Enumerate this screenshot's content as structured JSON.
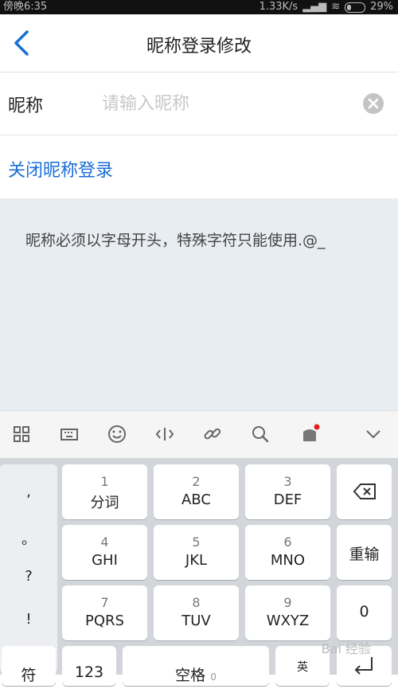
{
  "status": {
    "time": "傍晚6:35",
    "speed": "1.33K/s",
    "battery": "29%"
  },
  "nav": {
    "title": "昵称登录修改"
  },
  "nickname": {
    "label": "昵称",
    "placeholder": "请输入昵称",
    "value": ""
  },
  "close_login": {
    "label": "关闭昵称登录"
  },
  "hint": {
    "text": "昵称必须以字母开头，特殊字符只能使用.@_"
  },
  "keyboard": {
    "toolbar_icons": [
      "grid-icon",
      "keyboard-icon",
      "emoji-icon",
      "cursor-icon",
      "link-icon",
      "search-icon",
      "wallet-icon",
      "chevron-down-icon"
    ],
    "side_keys": [
      ",",
      "。",
      "?",
      "!"
    ],
    "keys": [
      {
        "num": "1",
        "label": "分词"
      },
      {
        "num": "2",
        "label": "ABC"
      },
      {
        "num": "3",
        "label": "DEF"
      },
      {
        "num": "4",
        "label": "GHI"
      },
      {
        "num": "5",
        "label": "JKL"
      },
      {
        "num": "6",
        "label": "MNO"
      },
      {
        "num": "7",
        "label": "PQRS"
      },
      {
        "num": "8",
        "label": "TUV"
      },
      {
        "num": "9",
        "label": "WXYZ"
      }
    ],
    "reenter": "重输",
    "zero": "0",
    "bottom": {
      "symbol": "符",
      "num_mode": "123",
      "space": "空格",
      "space_num": "0",
      "lang": "英"
    }
  },
  "watermark": "Bai 经验"
}
